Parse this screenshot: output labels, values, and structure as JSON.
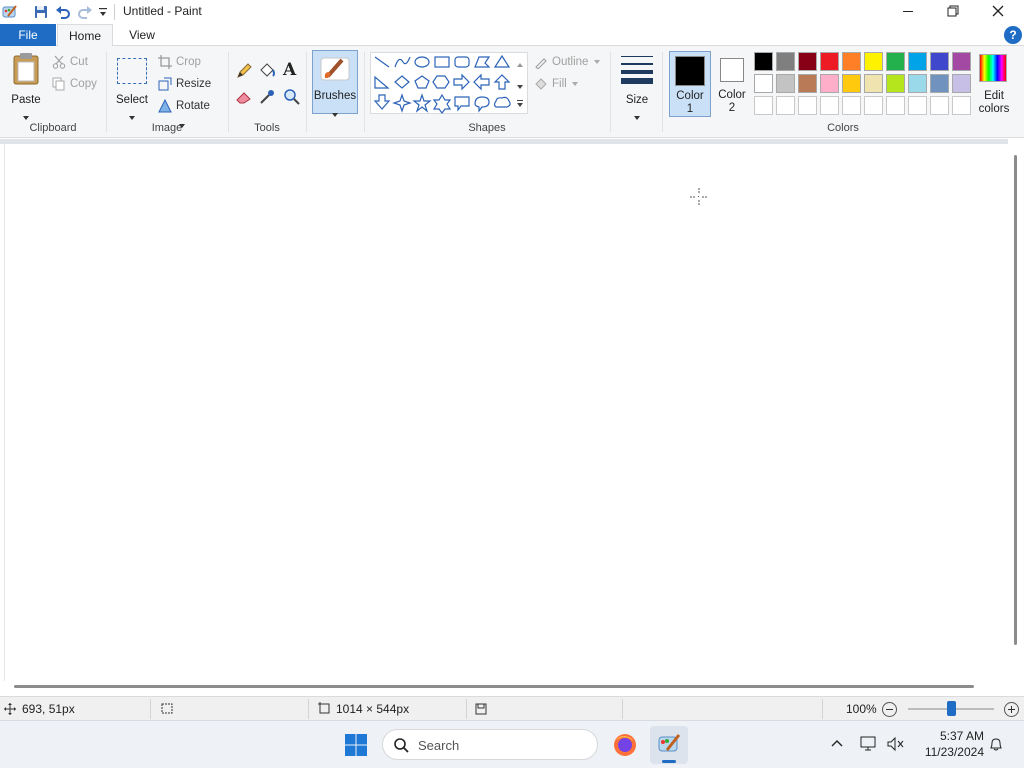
{
  "window": {
    "title": "Untitled - Paint",
    "minimize_icon": "minimize-icon",
    "maximize_icon": "restore-icon",
    "close_icon": "close-icon"
  },
  "quick_access": {
    "save_icon": "save-icon",
    "undo_icon": "undo-icon",
    "redo_icon": "redo-icon",
    "customize_icon": "dropdown-icon"
  },
  "tabs": [
    {
      "label": "File"
    },
    {
      "label": "Home"
    },
    {
      "label": "View"
    }
  ],
  "help_icon": "?",
  "ribbon": {
    "clipboard": {
      "label": "Clipboard",
      "paste": "Paste",
      "cut": "Cut",
      "copy": "Copy"
    },
    "image": {
      "label": "Image",
      "select": "Select",
      "crop": "Crop",
      "resize": "Resize",
      "rotate": "Rotate"
    },
    "tools": {
      "label": "Tools",
      "text_glyph": "A"
    },
    "brushes": {
      "label": "Brushes"
    },
    "shapes": {
      "label": "Shapes",
      "outline": "Outline",
      "fill": "Fill"
    },
    "size": {
      "label": "Size"
    },
    "color1": {
      "label_line1": "Color",
      "label_line2": "1",
      "color": "#000000"
    },
    "color2": {
      "label_line1": "Color",
      "label_line2": "2",
      "color": "#ffffff"
    },
    "colors": {
      "label": "Colors",
      "row1": [
        "#000000",
        "#7f7f7f",
        "#880015",
        "#ed1c24",
        "#ff7f27",
        "#fff200",
        "#22b14c",
        "#00a2e8",
        "#3f48cc",
        "#a349a4"
      ],
      "row2": [
        "#ffffff",
        "#c3c3c3",
        "#b97a57",
        "#ffaec9",
        "#ffc90e",
        "#efe4b0",
        "#b5e61d",
        "#99d9ea",
        "#7092be",
        "#c8bfe7"
      ],
      "edit_line1": "Edit",
      "edit_line2": "colors"
    }
  },
  "status": {
    "cursor_pos": "693, 51px",
    "canvas_size": "1014 × 544px",
    "zoom": "100%",
    "zoom_level": 0.5
  },
  "taskbar": {
    "search_placeholder": "Search",
    "time": "5:37 AM",
    "date": "11/23/2024"
  }
}
